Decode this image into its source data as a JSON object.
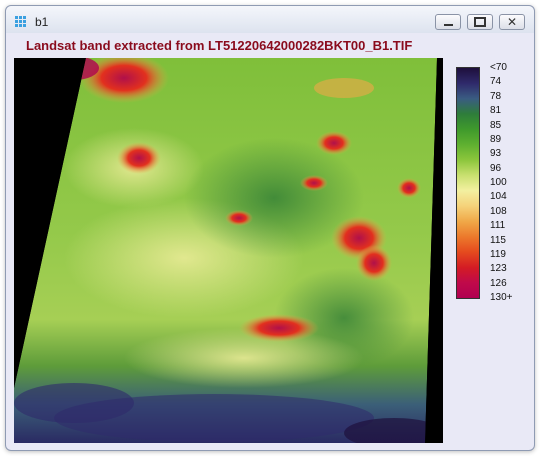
{
  "window": {
    "title": "b1",
    "icon": "grid-app-icon",
    "controls": [
      "minimize-icon",
      "restore-icon",
      "close-icon"
    ]
  },
  "map": {
    "title": "Landsat band extracted from LT51220642000282BKT00_B1.TIF",
    "title_color": "#8a0b1d"
  },
  "legend": {
    "labels": [
      "<70",
      "74",
      "78",
      "81",
      "85",
      "89",
      "93",
      "96",
      "100",
      "104",
      "108",
      "111",
      "115",
      "119",
      "123",
      "126",
      "130+"
    ],
    "colors": [
      "#1e0f3c",
      "#2f2a6b",
      "#3a5c82",
      "#2e7d3a",
      "#3f9a2c",
      "#5fb030",
      "#8cc63c",
      "#c9e070",
      "#f3f0a0",
      "#f5d27a",
      "#f0a848",
      "#ec7a2c",
      "#e54a1e",
      "#d41c24",
      "#c00a4a",
      "#b00050"
    ]
  }
}
